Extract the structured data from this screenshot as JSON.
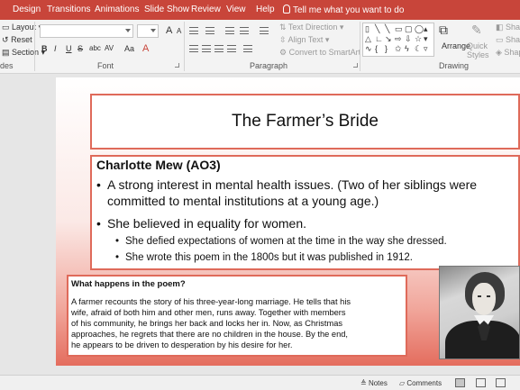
{
  "menu": {
    "items": [
      "Design",
      "Transitions",
      "Animations",
      "Slide Show",
      "Review",
      "View",
      "Help"
    ],
    "tell_me": "Tell me what you want to do"
  },
  "ribbon": {
    "slides_group": {
      "layout": "Layout",
      "reset": "Reset",
      "section": "Section",
      "label": "des"
    },
    "font_group": {
      "label": "Font",
      "bold": "B",
      "italic": "I",
      "underline": "U",
      "strike": "S",
      "shadow": "abc",
      "spacing": "AV",
      "case": "Aa",
      "grow": "A",
      "shrink": "A",
      "clear": "A"
    },
    "paragraph_group": {
      "label": "Paragraph",
      "text_direction": "Text Direction",
      "align_text": "Align Text",
      "smartart": "Convert to SmartArt"
    },
    "drawing_group": {
      "label": "Drawing",
      "arrange": "Arrange",
      "quick_styles": "Quick Styles",
      "shape_fill": "Shape",
      "shape_outline": "Shape",
      "shape_effects": "Shape"
    }
  },
  "slide": {
    "title": "The Farmer’s Bride",
    "heading": "Charlotte Mew (AO3)",
    "bullets": [
      {
        "line1": "A strong interest in mental health issues. (Two of her siblings were",
        "line2": "committed to mental institutions at a young age.)"
      },
      {
        "line1": "She believed in equality for women."
      }
    ],
    "subbullets": [
      "She defied expectations of women at the time in the way she dressed.",
      "She wrote this poem in the 1800s but it was published in 1912."
    ],
    "happens_heading": "What happens in the poem?",
    "happens_lines": [
      "A farmer recounts the story of his three-year-long marriage. He tells that his",
      "wife, afraid of both him and other men, runs away. Together with members",
      "of his community, he brings her back and locks her in. Now, as Christmas",
      "approaches, he regrets that there are no children in the house. By the end,",
      "he appears to be driven to desperation by his desire for her."
    ]
  },
  "status": {
    "notes": "Notes",
    "comments": "Comments"
  },
  "colors": {
    "accent": "#c8453a",
    "slide_border": "#df6a5a"
  }
}
